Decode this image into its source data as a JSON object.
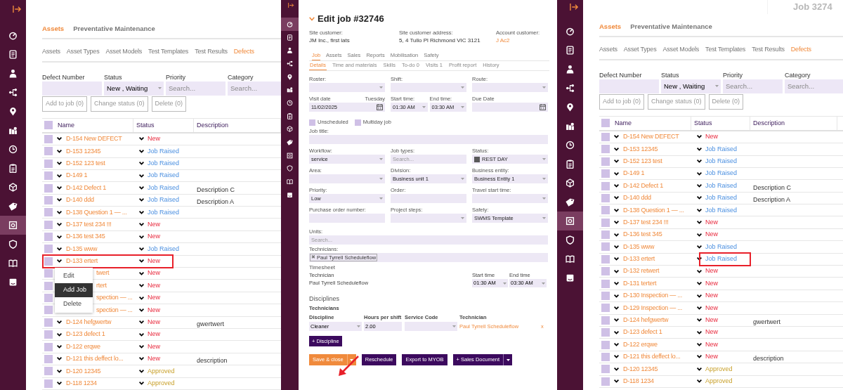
{
  "left_screen": {
    "sidebar": {
      "items": [
        {
          "selected": false
        },
        {
          "selected": false
        },
        {
          "selected": false
        },
        {
          "selected": false
        },
        {
          "selected": false
        },
        {
          "selected": false
        },
        {
          "selected": false
        },
        {
          "selected": false
        },
        {
          "selected": false
        },
        {
          "selected": false
        },
        {
          "selected": true
        },
        {
          "selected": false
        },
        {
          "selected": false
        },
        {
          "selected": false
        }
      ]
    },
    "top_tabs": [
      {
        "label": "Assets",
        "selected": true
      },
      {
        "label": "Preventative Maintenance",
        "selected": false
      }
    ],
    "sub_tabs": [
      {
        "label": "Assets",
        "selected": false
      },
      {
        "label": "Asset Types",
        "selected": false
      },
      {
        "label": "Asset Models",
        "selected": false
      },
      {
        "label": "Test Templates",
        "selected": false
      },
      {
        "label": "Test Results",
        "selected": false
      },
      {
        "label": "Defects",
        "selected": true
      }
    ],
    "filters": [
      {
        "label": "Defect Number",
        "kind": "input"
      },
      {
        "label": "Status",
        "kind": "select",
        "value": "New , Waiting"
      },
      {
        "label": "Priority",
        "kind": "input",
        "placeholder": "Search..."
      },
      {
        "label": "Category",
        "kind": "input",
        "placeholder": "Search..."
      }
    ],
    "actions": [
      "Add to job (0)",
      "Change status (0)",
      "Delete (0)"
    ],
    "table": {
      "all_checked": false,
      "columns": [
        "Name",
        "Status",
        "Description"
      ],
      "rows": [
        {
          "name": "D-154 New DEFECT",
          "status": {
            "text": "New",
            "kind": "new"
          },
          "checked": false,
          "highlighted": false
        },
        {
          "name": "D-153 12345",
          "status": {
            "text": "Job Raised",
            "kind": "job_raised"
          },
          "checked": false,
          "highlighted": false
        },
        {
          "name": "D-152 123 test",
          "status": {
            "text": "Job Raised",
            "kind": "job_raised"
          },
          "checked": false,
          "highlighted": false
        },
        {
          "name": "D-149 1",
          "status": {
            "text": "Job Raised",
            "kind": "job_raised"
          },
          "checked": false,
          "highlighted": false
        },
        {
          "name": "D-142 Defect 1",
          "status": {
            "text": "Job Raised",
            "kind": "job_raised"
          },
          "description": "Description C",
          "checked": false,
          "highlighted": false
        },
        {
          "name": "D-140 ddd",
          "status": {
            "text": "Job Raised",
            "kind": "job_raised"
          },
          "description": "Description A",
          "checked": false,
          "highlighted": false
        },
        {
          "name": "D-138 Question 1 — ...",
          "status": {
            "text": "Job Raised",
            "kind": "job_raised"
          },
          "checked": false,
          "highlighted": false
        },
        {
          "name": "D-137 test 234 !!!",
          "status": {
            "text": "New",
            "kind": "new"
          },
          "checked": false,
          "highlighted": false
        },
        {
          "name": "D-136 test 345",
          "status": {
            "text": "New",
            "kind": "new"
          },
          "checked": false,
          "highlighted": false
        },
        {
          "name": "D-135 www",
          "status": {
            "text": "Job Raised",
            "kind": "job_raised"
          },
          "checked": false,
          "highlighted": false
        },
        {
          "name": "D-133 ertert",
          "status": {
            "text": "New",
            "kind": "new"
          },
          "checked": false,
          "highlighted": true,
          "context_menu": [
            {
              "label": "Edit",
              "selected": false
            },
            {
              "label": "Add Job",
              "selected": true
            },
            {
              "label": "Delete",
              "selected": false
            }
          ]
        },
        {
          "name": "twert",
          "status": {
            "text": "New",
            "kind": "new"
          },
          "checked": false,
          "highlighted": false
        },
        {
          "name": "rtert",
          "status": {
            "text": "New",
            "kind": "new"
          },
          "checked": false,
          "highlighted": false
        },
        {
          "name": "spection — ...",
          "status": {
            "text": "New",
            "kind": "new"
          },
          "checked": false,
          "highlighted": false
        },
        {
          "name": "spection — ...",
          "status": {
            "text": "New",
            "kind": "new"
          },
          "checked": false,
          "highlighted": false
        },
        {
          "name": "D-124 hefgwertw",
          "status": {
            "text": "New",
            "kind": "new"
          },
          "description": "gwertwert",
          "checked": false,
          "highlighted": false
        },
        {
          "name": "D-123 defect 1",
          "status": {
            "text": "New",
            "kind": "new"
          },
          "checked": false,
          "highlighted": false
        },
        {
          "name": "D-122 erqwe",
          "status": {
            "text": "New",
            "kind": "new"
          },
          "checked": false,
          "highlighted": false
        },
        {
          "name": "D-121 this deffect lo...",
          "status": {
            "text": "New",
            "kind": "new"
          },
          "description": "description",
          "checked": false,
          "highlighted": false
        },
        {
          "name": "D-120 12345",
          "status": {
            "text": "Approved",
            "kind": "approved"
          },
          "checked": false,
          "highlighted": false
        },
        {
          "name": "D-118 1234",
          "status": {
            "text": "Approved",
            "kind": "approved"
          },
          "checked": false,
          "highlighted": false
        }
      ]
    }
  },
  "middle_screen": {
    "sidebar": {
      "items": [
        {
          "selected": true
        },
        {
          "selected": false
        },
        {
          "selected": false
        },
        {
          "selected": false
        },
        {
          "selected": false
        },
        {
          "selected": false
        },
        {
          "selected": false
        },
        {
          "selected": false
        },
        {
          "selected": false
        },
        {
          "selected": false
        },
        {
          "selected": false
        },
        {
          "selected": false
        },
        {
          "selected": false
        },
        {
          "selected": false
        }
      ]
    },
    "title": "Edit job #32746",
    "info": [
      {
        "label": "Site customer:",
        "value": "JM Inc., first lats",
        "link": false
      },
      {
        "label": "Site customer address:",
        "value": "5, 4 Tullo Pl Richmond VIC 3121",
        "link": false
      },
      {
        "label": "Account customer:",
        "value": "J Ac2",
        "link": true
      }
    ],
    "tabs": [
      {
        "label": "Job",
        "selected": true
      },
      {
        "label": "Assets",
        "selected": false
      },
      {
        "label": "Sales",
        "selected": false
      },
      {
        "label": "Reports",
        "selected": false
      },
      {
        "label": "Mobilisation",
        "selected": false
      },
      {
        "label": "Safety",
        "selected": false
      }
    ],
    "sub_tabs": [
      {
        "label": "Details",
        "selected": true
      },
      {
        "label": "Time and materials",
        "selected": false
      },
      {
        "label": "Skills",
        "selected": false
      },
      {
        "label": "To-do 0",
        "selected": false
      },
      {
        "label": "Visits 1",
        "selected": false
      },
      {
        "label": "Profit report",
        "selected": false
      },
      {
        "label": "History",
        "selected": false
      }
    ],
    "form_rows": [
      [
        {
          "kind": "select",
          "label": "Roster:"
        },
        {
          "kind": "select",
          "label": "Shift:"
        },
        {
          "kind": "select",
          "label": "Route:"
        }
      ],
      [
        {
          "kind": "date",
          "label": "Visit date",
          "aside": "Tuesday",
          "value": "11/02/2025"
        },
        {
          "kind": "time_pair",
          "fields": [
            {
              "label": "Start time:",
              "value": "01:30 AM"
            },
            {
              "label": "End time:",
              "value": "03:30 AM"
            }
          ]
        },
        {
          "kind": "date",
          "label": "Due Date"
        }
      ]
    ],
    "checkboxes": [
      {
        "label": "Unscheduled",
        "checked": false
      },
      {
        "label": "Multiday job",
        "checked": false
      }
    ],
    "job_title": {
      "label": "Job title:"
    },
    "form_rows_2": [
      [
        {
          "kind": "select",
          "label": "Workflow:",
          "value": "service"
        },
        {
          "kind": "input",
          "label": "Job types:",
          "placeholder": "Search..."
        },
        {
          "kind": "select",
          "label": "Status:",
          "value": "REST DAY",
          "color": "#5a5a5a"
        }
      ],
      [
        {
          "kind": "select",
          "label": "Area:"
        },
        {
          "kind": "select",
          "label": "Division:",
          "value": "Business unit 1"
        },
        {
          "kind": "select",
          "label": "Business entity:",
          "value": "Business Entity 1"
        }
      ],
      [
        {
          "kind": "select",
          "label": "Priority:",
          "value": "Low"
        },
        {
          "kind": "input",
          "label": "Order:"
        },
        {
          "kind": "select",
          "label": "Travel start time:"
        }
      ],
      [
        {
          "kind": "input",
          "label": "Purchase order number:"
        },
        {
          "kind": "select",
          "label": "Project steps:"
        },
        {
          "kind": "select",
          "label": "Safety:",
          "value": "SWMS Template"
        }
      ]
    ],
    "units": {
      "label": "Units:",
      "placeholder": "Search..."
    },
    "technicians": {
      "label": "Technicians:",
      "chips": [
        {
          "remove": "✖",
          "label": "Paul Tyrrell Scheduleflow"
        }
      ]
    },
    "timesheet": {
      "title": "Timesheet",
      "columns": [
        "Technician",
        "Start time",
        "End time"
      ],
      "rows": [
        {
          "technician": "Paul Tyrrell Scheduleflow",
          "start": "01:30 AM",
          "end": "03:30 AM"
        }
      ]
    },
    "disciplines": {
      "title": "Disciplines",
      "subtitle": "Technicians",
      "columns": [
        "Discipline",
        "Hours per shift",
        "Service Code",
        "Technician"
      ],
      "rows": [
        {
          "discipline": "Cleaner",
          "hours": "2.00",
          "technician": "Paul Tyrrell Scheduleflow",
          "remove": "x"
        }
      ],
      "add_button": "+ Discipline"
    },
    "actions": [
      {
        "label": "Save & close",
        "kind": "split_primary"
      },
      {
        "label": "Reschedule",
        "kind": "plain"
      },
      {
        "label": "Export to MYOB",
        "kind": "plain"
      },
      {
        "label": "+ Sales Document",
        "kind": "split"
      }
    ]
  },
  "right_screen": {
    "header_title": "Job 3274",
    "sidebar": {
      "items": [
        {
          "selected": false
        },
        {
          "selected": false
        },
        {
          "selected": false
        },
        {
          "selected": false
        },
        {
          "selected": false
        },
        {
          "selected": false
        },
        {
          "selected": false
        },
        {
          "selected": false
        },
        {
          "selected": false
        },
        {
          "selected": false
        },
        {
          "selected": true
        },
        {
          "selected": false
        },
        {
          "selected": false
        },
        {
          "selected": false
        }
      ]
    },
    "top_tabs": [
      {
        "label": "Assets",
        "selected": true
      },
      {
        "label": "Preventative Maintenance",
        "selected": false
      }
    ],
    "sub_tabs": [
      {
        "label": "Assets",
        "selected": false
      },
      {
        "label": "Asset Types",
        "selected": false
      },
      {
        "label": "Asset Models",
        "selected": false
      },
      {
        "label": "Test Templates",
        "selected": false
      },
      {
        "label": "Test Results",
        "selected": false
      },
      {
        "label": "Defects",
        "selected": true
      }
    ],
    "filters": [
      {
        "label": "Defect Number",
        "kind": "input"
      },
      {
        "label": "Status",
        "kind": "select",
        "value": "New , Waiting"
      },
      {
        "label": "Priority",
        "kind": "input",
        "placeholder": "Search..."
      },
      {
        "label": "Category",
        "kind": "input",
        "placeholder": "Search..."
      }
    ],
    "actions": [
      "Add to job (0)",
      "Change status (0)",
      "Delete (0)"
    ],
    "table": {
      "all_checked": false,
      "columns": [
        "Name",
        "Status",
        "Description"
      ],
      "rows": [
        {
          "name": "D-154 New DEFECT",
          "status": {
            "text": "New",
            "kind": "new"
          },
          "checked": false,
          "status_highlighted": false
        },
        {
          "name": "D-153 12345",
          "status": {
            "text": "Job Raised",
            "kind": "job_raised"
          },
          "checked": false,
          "status_highlighted": false
        },
        {
          "name": "D-152 123 test",
          "status": {
            "text": "Job Raised",
            "kind": "job_raised"
          },
          "checked": false,
          "status_highlighted": false
        },
        {
          "name": "D-149 1",
          "status": {
            "text": "Job Raised",
            "kind": "job_raised"
          },
          "checked": false,
          "status_highlighted": false
        },
        {
          "name": "D-142 Defect 1",
          "status": {
            "text": "Job Raised",
            "kind": "job_raised"
          },
          "description": "Description C",
          "checked": false,
          "status_highlighted": false
        },
        {
          "name": "D-140 ddd",
          "status": {
            "text": "Job Raised",
            "kind": "job_raised"
          },
          "description": "Description A",
          "checked": false,
          "status_highlighted": false
        },
        {
          "name": "D-138 Question 1 — ...",
          "status": {
            "text": "Job Raised",
            "kind": "job_raised"
          },
          "checked": false,
          "status_highlighted": false
        },
        {
          "name": "D-137 test 234 !!!",
          "status": {
            "text": "New",
            "kind": "new"
          },
          "checked": false,
          "status_highlighted": false
        },
        {
          "name": "D-136 test 345",
          "status": {
            "text": "New",
            "kind": "new"
          },
          "checked": false,
          "status_highlighted": false
        },
        {
          "name": "D-135 www",
          "status": {
            "text": "Job Raised",
            "kind": "job_raised"
          },
          "checked": false,
          "status_highlighted": false
        },
        {
          "name": "D-133 ertert",
          "status": {
            "text": "Job Raised",
            "kind": "job_raised"
          },
          "checked": false,
          "status_highlighted": true
        },
        {
          "name": "D-132 retwert",
          "status": {
            "text": "New",
            "kind": "new"
          },
          "checked": false,
          "status_highlighted": false
        },
        {
          "name": "D-131 tertert",
          "status": {
            "text": "New",
            "kind": "new"
          },
          "checked": false,
          "status_highlighted": false
        },
        {
          "name": "D-130 Inspection — ...",
          "status": {
            "text": "New",
            "kind": "new"
          },
          "checked": false,
          "status_highlighted": false
        },
        {
          "name": "D-129 Inspection — ...",
          "status": {
            "text": "New",
            "kind": "new"
          },
          "checked": false,
          "status_highlighted": false
        },
        {
          "name": "D-124 hefgwertw",
          "status": {
            "text": "New",
            "kind": "new"
          },
          "description": "gwertwert",
          "checked": false,
          "status_highlighted": false
        },
        {
          "name": "D-123 defect 1",
          "status": {
            "text": "New",
            "kind": "new"
          },
          "checked": false,
          "status_highlighted": false
        },
        {
          "name": "D-122 erqwe",
          "status": {
            "text": "New",
            "kind": "new"
          },
          "checked": false,
          "status_highlighted": false
        },
        {
          "name": "D-121 this deffect lo...",
          "status": {
            "text": "New",
            "kind": "new"
          },
          "description": "description",
          "checked": false,
          "status_highlighted": false
        },
        {
          "name": "D-120 12345",
          "status": {
            "text": "Approved",
            "kind": "approved"
          },
          "checked": false,
          "status_highlighted": false
        },
        {
          "name": "D-118 1234",
          "status": {
            "text": "Approved",
            "kind": "approved"
          },
          "checked": false,
          "status_highlighted": false
        }
      ]
    }
  }
}
